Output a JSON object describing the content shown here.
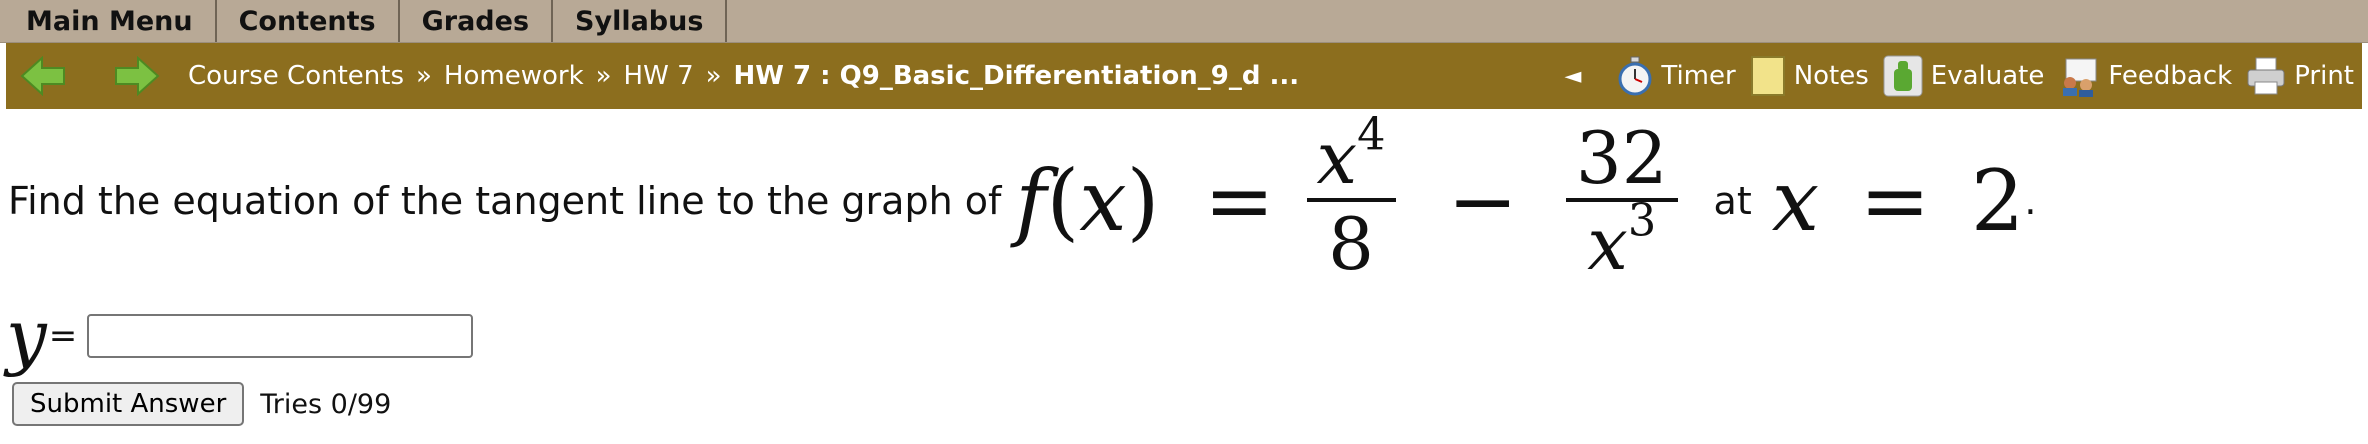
{
  "menu": {
    "tabs": [
      "Main Menu",
      "Contents",
      "Grades",
      "Syllabus"
    ]
  },
  "navbar": {
    "breadcrumbs": [
      "Course Contents",
      "Homework",
      "HW 7"
    ],
    "separator": "»",
    "current": "HW 7 : Q9_Basic_Differentiation_9_d ...",
    "collapse_symbol": "◄",
    "tools": {
      "timer": "Timer",
      "notes": "Notes",
      "evaluate": "Evaluate",
      "feedback": "Feedback",
      "print": "Print"
    },
    "colors": {
      "bar": "#8c6e1e",
      "arrows": "#7cc142"
    }
  },
  "question": {
    "prefix": "Find the equation of the tangent line to the graph of",
    "func": "f",
    "var": "x",
    "lparen": "(",
    "rparen": ")",
    "eq": "=",
    "frac1": {
      "num_base": "x",
      "num_exp": "4",
      "den": "8"
    },
    "minus": "−",
    "frac2": {
      "num": "32",
      "den_base": "x",
      "den_exp": "3"
    },
    "at_word": "at",
    "point_var": "x",
    "point_eq": "=",
    "point_val": "2",
    "period": "."
  },
  "answer": {
    "var": "y",
    "eq": "=",
    "value": ""
  },
  "submit": {
    "label": "Submit Answer",
    "tries": "Tries 0/99"
  }
}
